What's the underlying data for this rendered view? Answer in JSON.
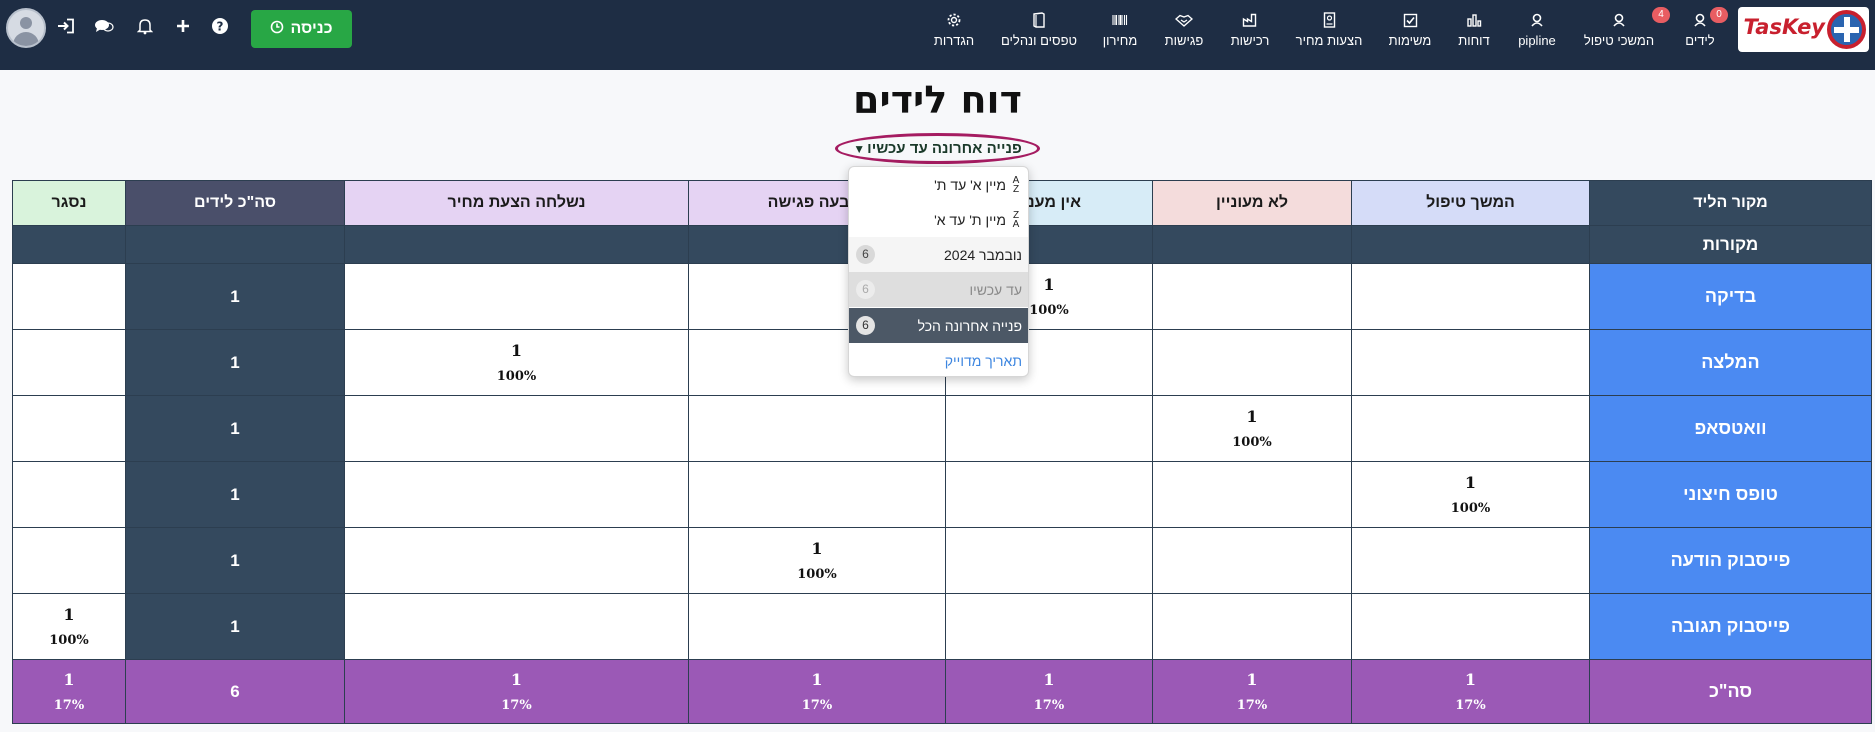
{
  "brand": {
    "name": "TasKey"
  },
  "nav": {
    "items": [
      {
        "label": "לידים",
        "badge": "0",
        "icon": "user-icon"
      },
      {
        "label": "המשכי טיפול",
        "badge": "4",
        "icon": "user-icon"
      },
      {
        "label": "pipline",
        "icon": "user-icon"
      },
      {
        "label": "דוחות",
        "icon": "bar-chart-icon"
      },
      {
        "label": "משימות",
        "icon": "checkbox-icon"
      },
      {
        "label": "הצעות מחיר",
        "icon": "document-icon"
      },
      {
        "label": "רכישות",
        "icon": "factory-icon"
      },
      {
        "label": "פגישות",
        "icon": "handshake-icon"
      },
      {
        "label": "מחירון",
        "icon": "barcode-icon"
      },
      {
        "label": "טפסים ונהלים",
        "icon": "book-icon"
      },
      {
        "label": "הגדרות",
        "icon": "gear-icon"
      }
    ],
    "enter_button": "כניסה"
  },
  "page": {
    "title": "דוח לידים",
    "filter_label": "פנייה אחרונה עד עכשיו"
  },
  "dropdown": {
    "sort_asc": "מיין א' עד ת'",
    "sort_desc": "מיין ת' עד א'",
    "options": [
      {
        "label": "נובמבר 2024",
        "count": "6",
        "state": "hover"
      },
      {
        "label": "עד עכשיו",
        "count": "6",
        "state": "disabled"
      },
      {
        "label": "פנייה אחרונה הכל",
        "count": "6",
        "state": "active"
      }
    ],
    "exact_date": "תאריך מדוייק"
  },
  "table": {
    "headers": {
      "source": "מקור הליד",
      "followup": "המשך טיפול",
      "not_interested": "לא מעוניין",
      "no_answer": "אין מענה",
      "meeting": "נקבעה פגישה",
      "quote_sent": "נשלחה הצעת מחיר",
      "total_leads": "סה\"כ לידים",
      "closed": "נסגר"
    },
    "header_colors": {
      "source": "#34495e",
      "followup": "#d5dcf8",
      "not_interested": "#f4dcdc",
      "no_answer": "#d7ecf7",
      "meeting": "#e5d3f3",
      "quote_sent": "#e5d3f3",
      "total_leads": "#4a4f6a",
      "closed": "#d9f3dc"
    },
    "section_label": "מקורות",
    "rows": [
      {
        "name": "בדיקה",
        "total": "1",
        "no_answer": {
          "value": "1",
          "pct": "100%"
        }
      },
      {
        "name": "המלצה",
        "total": "1",
        "quote_sent": {
          "value": "1",
          "pct": "100%"
        }
      },
      {
        "name": "וואטסאפ",
        "total": "1",
        "not_interested": {
          "value": "1",
          "pct": "100%"
        }
      },
      {
        "name": "טופס חיצוני",
        "total": "1",
        "followup": {
          "value": "1",
          "pct": "100%"
        }
      },
      {
        "name": "פייסבוק הודעה",
        "total": "1",
        "meeting": {
          "value": "1",
          "pct": "100%"
        }
      },
      {
        "name": "פייסבוק תגובה",
        "total": "1",
        "closed": {
          "value": "1",
          "pct": "100%"
        }
      }
    ],
    "totals": {
      "name": "סה\"כ",
      "total": "6",
      "followup": {
        "value": "1",
        "pct": "17%"
      },
      "not_interested": {
        "value": "1",
        "pct": "17%"
      },
      "no_answer": {
        "value": "1",
        "pct": "17%"
      },
      "meeting": {
        "value": "1",
        "pct": "17%"
      },
      "quote_sent": {
        "value": "1",
        "pct": "17%"
      },
      "closed": {
        "value": "1",
        "pct": "17%"
      }
    }
  }
}
